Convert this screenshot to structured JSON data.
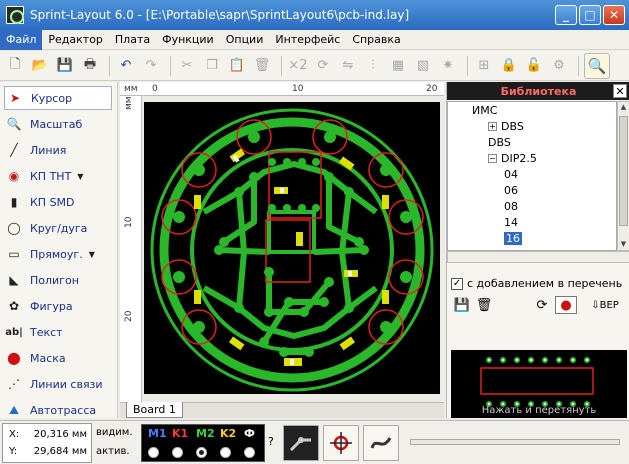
{
  "window": {
    "title": "Sprint-Layout 6.0 - [E:\\Portable\\sapr\\SprintLayout6\\pcb-ind.lay]",
    "buttons": [
      "_",
      "□",
      "✕"
    ]
  },
  "menu": [
    {
      "label": "Файл",
      "active": true
    },
    {
      "label": "Редактор"
    },
    {
      "label": "Плата"
    },
    {
      "label": "Функции"
    },
    {
      "label": "Опции"
    },
    {
      "label": "Интерфейс"
    },
    {
      "label": "Справка"
    }
  ],
  "toolbar": {
    "x2_label": "×2"
  },
  "tools": [
    {
      "label": "Курсор",
      "icon": "cursor-arrow-icon",
      "active": true
    },
    {
      "label": "Масштаб",
      "icon": "zoom-icon"
    },
    {
      "label": "Линия",
      "icon": "line-icon"
    },
    {
      "label": "КП ТНТ",
      "icon": "tht-pad-icon",
      "dropdown": true
    },
    {
      "label": "КП SMD",
      "icon": "smd-pad-icon"
    },
    {
      "label": "Круг/дуга",
      "icon": "circle-arc-icon"
    },
    {
      "label": "Прямоуг.",
      "icon": "rectangle-icon",
      "dropdown": true
    },
    {
      "label": "Полигон",
      "icon": "polygon-icon"
    },
    {
      "label": "Фигура",
      "icon": "figure-icon"
    },
    {
      "label": "Текст",
      "icon": "text-icon"
    },
    {
      "label": "Маска",
      "icon": "mask-icon"
    },
    {
      "label": "Линии связи",
      "icon": "connection-lines-icon"
    },
    {
      "label": "Автотрасса",
      "icon": "autoroute-icon"
    }
  ],
  "rulers": {
    "unit": "мм",
    "top": [
      "0",
      "10",
      "20"
    ],
    "left": [
      "10",
      "20"
    ]
  },
  "board_tab": "Board 1",
  "library": {
    "title": "Библиотека",
    "close": "✕",
    "tree": [
      {
        "label": "ИМС",
        "level": 0,
        "expander": "none"
      },
      {
        "label": "DBS",
        "level": 1,
        "expander": "+"
      },
      {
        "label": "DBS",
        "level": 1,
        "expander": "none"
      },
      {
        "label": "DIP2.5",
        "level": 1,
        "expander": "-"
      },
      {
        "label": "04",
        "level": 2
      },
      {
        "label": "06",
        "level": 2
      },
      {
        "label": "08",
        "level": 2
      },
      {
        "label": "14",
        "level": 2
      },
      {
        "label": "16",
        "level": 2,
        "selected": true
      }
    ],
    "checkbox_label": "с добавлением в перечень",
    "checkbox_mark": "✓",
    "ber_label": "BEP",
    "preview_hint": "Нажать и перетянуть"
  },
  "status": {
    "x_label": "X:",
    "x_value": "20,316 мм",
    "y_label": "Y:",
    "y_value": "29,684 мм",
    "visible_label": "видим.",
    "active_label": "актив.",
    "layers": [
      {
        "name": "M1",
        "color": "#4a7dff"
      },
      {
        "name": "K1",
        "color": "#ff3b3b"
      },
      {
        "name": "M2",
        "color": "#3cd23c"
      },
      {
        "name": "K2",
        "color": "#f0d020"
      },
      {
        "name": "Ф",
        "color": "#ffffff"
      }
    ],
    "active_layer_index": 2,
    "help": "?"
  },
  "colors": {
    "track": "#2ab82a",
    "pad": "#e0e000",
    "smd": "#f2f2f2",
    "outline": "#e02020"
  }
}
